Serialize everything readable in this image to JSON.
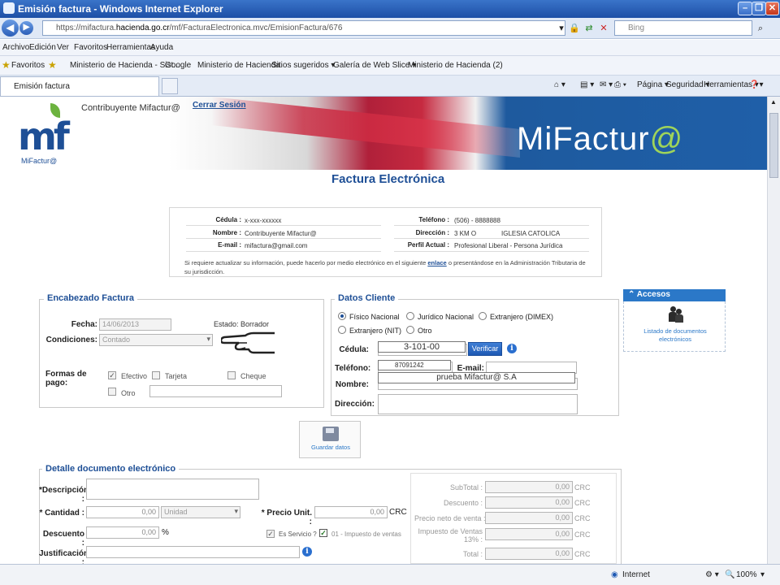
{
  "window": {
    "title": "Emisión factura - Windows Internet Explorer",
    "minimize_glyph": "–",
    "restore_glyph": "❐",
    "close_glyph": "✕"
  },
  "address": {
    "url_scheme": "https://",
    "url_prefix": "mifactura.",
    "url_domain": "hacienda.go.cr",
    "url_path": "/mf/FacturaElectronica.mvc/EmisionFactura/676",
    "search_placeholder": "Bing"
  },
  "menu": [
    "Archivo",
    "Edición",
    "Ver",
    "Favoritos",
    "Herramientas",
    "Ayuda"
  ],
  "favorites": {
    "label": "Favoritos",
    "items": [
      "Ministerio de Hacienda - Sist...",
      "Google",
      "Ministerio de Hacienda",
      "Sitios sugeridos ▾",
      "Galería de Web Slice ▾",
      "Ministerio de Hacienda (2)"
    ]
  },
  "tab": {
    "title": "Emisión factura",
    "commands": [
      "Página ▾",
      "Seguridad ▾",
      "Herramientas ▾"
    ]
  },
  "header": {
    "contribuyente": "Contribuyente Mifactur@",
    "logout": "Cerrar Sesión",
    "logo_letters": "mf",
    "logo_text": "MiFactur@",
    "brand_main": "MiFactur",
    "brand_at": "@",
    "page_title": "Factura Electrónica"
  },
  "info": {
    "cedula_label": "Cédula :",
    "cedula_value": "x-xxx-xxxxxx",
    "nombre_label": "Nombre :",
    "nombre_value": "Contribuyente Mifactur@",
    "email_label": "E-mail :",
    "email_value": "mifactura@gmail.com",
    "telefono_label": "Teléfono :",
    "telefono_value": "(506) - 8888888",
    "direccion_label": "Dirección :",
    "direccion_value": "3 KM O",
    "direccion_extra": "IGLESIA CATOLICA",
    "perfil_label": "Perfil Actual :",
    "perfil_value": "Profesional Liberal - Persona Jurídica",
    "note_before": "Si requiere actualizar su información, puede hacerlo por medio electrónico en el siguiente",
    "note_link": "enlace",
    "note_after": "o presentándose en la Administración Tributaria de su jurisdicción."
  },
  "encabezado": {
    "legend": "Encabezado Factura",
    "fecha_label": "Fecha:",
    "fecha_value": "14/06/2013",
    "estado_label": "Estado:",
    "estado_value": "Borrador",
    "condiciones_label": "Condiciones:",
    "condiciones_value": "Contado",
    "formas_label": "Formas de pago:",
    "pagos": [
      {
        "label": "Efectivo",
        "checked": true
      },
      {
        "label": "Tarjeta",
        "checked": false
      },
      {
        "label": "Cheque",
        "checked": false
      },
      {
        "label": "Otro",
        "checked": false
      }
    ]
  },
  "cliente": {
    "legend": "Datos Cliente",
    "tipos": [
      {
        "label": "Físico Nacional",
        "selected": true
      },
      {
        "label": "Jurídico Nacional",
        "selected": false
      },
      {
        "label": "Extranjero (DIMEX)",
        "selected": false
      },
      {
        "label": "Extranjero (NIT)",
        "selected": false
      },
      {
        "label": "Otro",
        "selected": false
      }
    ],
    "cedula_label": "Cédula:",
    "cedula_value": "3-101-00",
    "verificar": "Verificar",
    "telefono_label": "Teléfono:",
    "telefono_value": "87091242",
    "email_label": "E-mail:",
    "nombre_label": "Nombre:",
    "nombre_value": "prueba Mifactur@ S.A",
    "direccion_label": "Dirección:"
  },
  "accesos": {
    "title": "Accesos",
    "link": "Listado de documentos electrónicos"
  },
  "guardar": {
    "label": "Guardar datos"
  },
  "detalle": {
    "legend": "Detalle documento electrónico",
    "descripcion_label": "*Descripción :",
    "cantidad_label": "* Cantidad :",
    "cantidad_value": "0,00",
    "unidad_value": "Unidad",
    "precio_label": "* Precio Unit. :",
    "precio_value": "0,00",
    "currency": "CRC",
    "descuento_label": "Descuento :",
    "descuento_value": "0,00",
    "percent": "%",
    "es_servicio": "Es Servicio ?",
    "impuesto": "01 - Impuesto de ventas",
    "justificacion_label": "Justificación :"
  },
  "totales": {
    "subtotal_label": "SubTotal :",
    "descuento_label": "Descuento :",
    "precio_neto_label": "Precio neto de venta :",
    "impuesto_label": "Impuesto de Ventas 13% :",
    "total_label": "Total :",
    "value": "0,00",
    "currency": "CRC"
  },
  "status": {
    "zone": "Internet",
    "zoom": "100%"
  }
}
